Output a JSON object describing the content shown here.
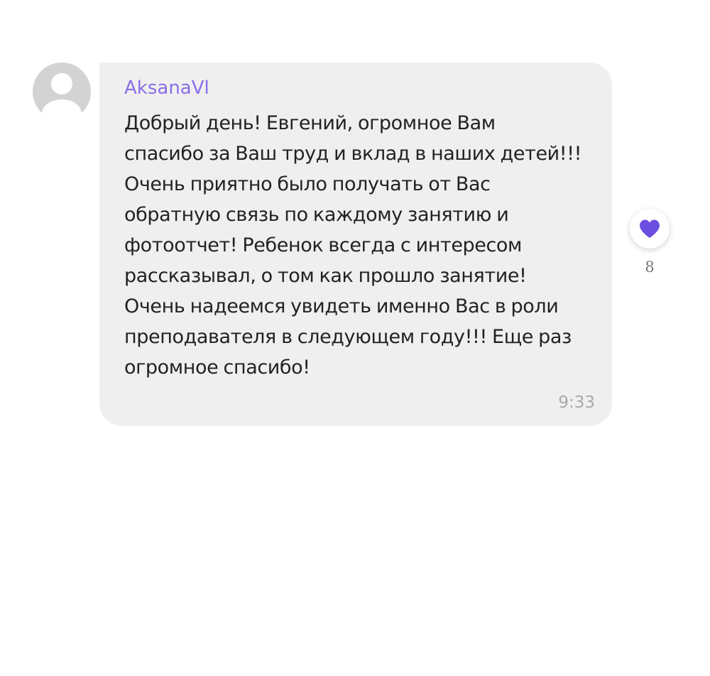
{
  "message": {
    "author": "AksanaVl",
    "lines": [
      "Добрый день! Евгений, огромное Вам",
      "спасибо за Ваш труд и вклад в наших детей!!!",
      "Очень приятно было получать от Вас",
      "обратную связь по каждому занятию и",
      "фотоотчет! Ребенок всегда с интересом",
      "рассказывал, о том как прошло занятие!",
      "Очень надеемся увидеть именно Вас в роли",
      "преподавателя в следующем году!!! Еще раз",
      "огромное спасибо!"
    ],
    "time": "9:33"
  },
  "reaction": {
    "icon": "heart-icon",
    "count": "8",
    "color": "#6b4ee0"
  },
  "colors": {
    "author": "#8b6fe6",
    "bubble": "#efefef",
    "avatar": "#d3d3d3"
  }
}
